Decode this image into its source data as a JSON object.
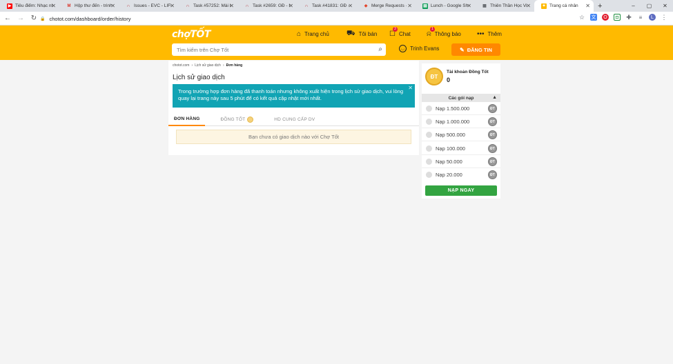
{
  "browser": {
    "tabs": [
      {
        "title": "Tiêu điểm: Nhạc nh",
        "icon": "youtube-icon",
        "color": "#ff0000"
      },
      {
        "title": "Hộp thư đến - trinh",
        "icon": "gmail-icon",
        "color": "#d93025"
      },
      {
        "title": "Issues - EVC - LIFET",
        "icon": "redmine-icon",
        "color": "#b32024"
      },
      {
        "title": "Task #57252: Mài bị",
        "icon": "redmine-icon",
        "color": "#b32024"
      },
      {
        "title": "Task #2659: GĐ - H",
        "icon": "redmine-icon",
        "color": "#b32024"
      },
      {
        "title": "Task #41831: GĐ - I",
        "icon": "redmine-icon",
        "color": "#b32024"
      },
      {
        "title": "Merge Requests · E",
        "icon": "gitlab-icon",
        "color": "#e24329"
      },
      {
        "title": "Lunch - Google She",
        "icon": "sheets-icon",
        "color": "#0f9d58"
      },
      {
        "title": "Thiên Thần Học Việ",
        "icon": "sheet-grid-icon",
        "color": "#5f6368"
      },
      {
        "title": "Trang cá nhân",
        "icon": "chotot-icon",
        "color": "#ffba00",
        "active": true
      }
    ],
    "url": "chotot.com/dashboard/order/history",
    "window_buttons": [
      "–",
      "▢",
      "✕"
    ]
  },
  "header": {
    "logo": "chợTỐT",
    "nav": {
      "home": "Trang chủ",
      "my_shop": "Tôi bán",
      "chat": "Chat",
      "chat_badge": "3",
      "notifications": "Thông báo",
      "notifications_badge": "1",
      "more": "Thêm"
    },
    "search_placeholder": "Tìm kiếm trên Chợ Tốt",
    "user_name": "Trinh Evans",
    "post_button": "ĐĂNG TIN"
  },
  "main": {
    "breadcrumb": [
      "chotot.com",
      "Lịch sử giao dịch",
      "Đơn hàng"
    ],
    "title": "Lịch sử giao dịch",
    "notice": "Trong trường hợp đơn hàng đã thanh toán nhưng không xuất hiện trong lịch sử giao dịch, vui lòng quay lại trang này sau 5 phút để có kết quả cập nhật mới nhất.",
    "tabs": [
      "ĐƠN HÀNG",
      "ĐỒNG TỐT",
      "HD CUNG CẤP DV"
    ],
    "empty_message": "Bạn chưa có giao dịch nào với Chợ Tốt"
  },
  "sidebar": {
    "coin_badge": "ĐT",
    "account_label": "Tài khoản Đồng Tốt",
    "balance": "0",
    "packages_header": "Các gói nạp",
    "packages": [
      "Nạp 1.500.000",
      "Nạp 1.000.000",
      "Nạp 500.000",
      "Nạp 100.000",
      "Nạp 50.000",
      "Nạp 20.000"
    ],
    "topup_button": "NẠP NGAY"
  }
}
